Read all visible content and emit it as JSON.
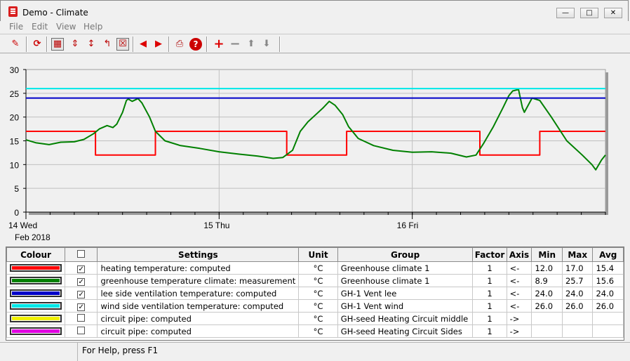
{
  "window": {
    "app": "Demo",
    "separator": " - ",
    "doc": "Climate"
  },
  "menu": [
    "File",
    "Edit",
    "View",
    "Help"
  ],
  "toolbar_icons": [
    "edit-icon",
    "refresh-icon",
    "grid-icon",
    "compress-vertical-icon",
    "expand-vertical-icon",
    "cursor-measure-icon",
    "clear-icon",
    "arrow-left-icon",
    "arrow-right-icon",
    "print-icon",
    "help-icon",
    "add-icon",
    "remove-icon",
    "move-up-icon",
    "move-down-icon"
  ],
  "chart_data": {
    "type": "line",
    "ylim": [
      0,
      30
    ],
    "yticks": [
      0,
      5,
      10,
      15,
      20,
      25,
      30
    ],
    "xlim": [
      0,
      3
    ],
    "x_unit": "days from 14 Feb 2018 00:00",
    "xticks": [
      {
        "x": 0,
        "label": "14 Wed",
        "sub": "Feb 2018"
      },
      {
        "x": 1,
        "label": "15 Thu",
        "sub": ""
      },
      {
        "x": 2,
        "label": "16 Fri",
        "sub": ""
      }
    ],
    "grid": true,
    "series": [
      {
        "name": "heating temperature: computed",
        "color": "#ff0000",
        "step": true,
        "x": [
          0,
          0.36,
          0.36,
          0.67,
          0.67,
          1.35,
          1.35,
          1.66,
          1.66,
          2.35,
          2.35,
          2.66,
          2.66,
          3.0
        ],
        "y": [
          17,
          17,
          12,
          12,
          17,
          17,
          12,
          12,
          17,
          17,
          12,
          12,
          17,
          17
        ]
      },
      {
        "name": "greenhouse temperature climate: measurement",
        "color": "#008000",
        "step": false,
        "x": [
          0,
          0.05,
          0.12,
          0.18,
          0.25,
          0.3,
          0.35,
          0.38,
          0.42,
          0.45,
          0.47,
          0.5,
          0.52,
          0.53,
          0.55,
          0.58,
          0.6,
          0.64,
          0.67,
          0.72,
          0.8,
          0.9,
          1.0,
          1.1,
          1.2,
          1.28,
          1.33,
          1.38,
          1.42,
          1.46,
          1.5,
          1.54,
          1.57,
          1.6,
          1.64,
          1.67,
          1.72,
          1.8,
          1.9,
          2.0,
          2.1,
          2.2,
          2.28,
          2.33,
          2.37,
          2.42,
          2.47,
          2.5,
          2.52,
          2.55,
          2.57,
          2.58,
          2.62,
          2.66,
          2.72,
          2.8,
          2.88,
          2.93,
          2.95,
          2.98,
          3.0
        ],
        "y": [
          15.2,
          14.6,
          14.2,
          14.7,
          14.8,
          15.3,
          16.5,
          17.5,
          18.2,
          17.8,
          18.5,
          21.0,
          23.5,
          23.8,
          23.3,
          23.9,
          23.0,
          20.0,
          17.0,
          15.0,
          14.0,
          13.4,
          12.7,
          12.2,
          11.8,
          11.3,
          11.5,
          13.0,
          17.0,
          19.0,
          20.5,
          22.0,
          23.3,
          22.5,
          20.5,
          18.0,
          15.5,
          14.0,
          13.0,
          12.6,
          12.7,
          12.4,
          11.6,
          12.0,
          14.5,
          18.0,
          22.0,
          24.5,
          25.5,
          25.8,
          22.0,
          21.0,
          24.0,
          23.5,
          20.0,
          15.0,
          12.0,
          10.0,
          8.9,
          11.0,
          12.0
        ]
      },
      {
        "name": "lee side ventilation temperature: computed",
        "color": "#0000c8",
        "step": false,
        "x": [
          0,
          3.0
        ],
        "y": [
          24,
          24
        ]
      },
      {
        "name": "wind side ventilation temperature: computed",
        "color": "#00e8e8",
        "step": false,
        "x": [
          0,
          3.0
        ],
        "y": [
          26,
          26
        ]
      }
    ]
  },
  "table": {
    "headers": [
      "Colour",
      "",
      "Settings",
      "Unit",
      "Group",
      "Factor",
      "Axis",
      "Min",
      "Max",
      "Avg"
    ],
    "rows": [
      {
        "color": "#ff0000",
        "checked": true,
        "setting": "heating temperature: computed",
        "unit": "°C",
        "group": "Greenhouse climate 1",
        "factor": "1",
        "axis": "<-",
        "min": "12.0",
        "max": "17.0",
        "avg": "15.4"
      },
      {
        "color": "#008000",
        "checked": true,
        "setting": "greenhouse temperature climate: measurement",
        "unit": "°C",
        "group": "Greenhouse climate 1",
        "factor": "1",
        "axis": "<-",
        "min": "8.9",
        "max": "25.7",
        "avg": "15.6"
      },
      {
        "color": "#0000c8",
        "checked": true,
        "setting": "lee side ventilation temperature: computed",
        "unit": "°C",
        "group": "GH-1 Vent lee",
        "factor": "1",
        "axis": "<-",
        "min": "24.0",
        "max": "24.0",
        "avg": "24.0"
      },
      {
        "color": "#00e8e8",
        "checked": true,
        "setting": "wind side ventilation temperature: computed",
        "unit": "°C",
        "group": "GH-1 Vent wind",
        "factor": "1",
        "axis": "<-",
        "min": "26.0",
        "max": "26.0",
        "avg": "26.0"
      },
      {
        "color": "#f0f000",
        "checked": false,
        "setting": "circuit pipe: computed",
        "unit": "°C",
        "group": "GH-seed Heating Circuit middle",
        "factor": "1",
        "axis": "->",
        "min": "",
        "max": "",
        "avg": ""
      },
      {
        "color": "#e000e0",
        "checked": false,
        "setting": "circuit pipe: computed",
        "unit": "°C",
        "group": "GH-seed Heating Circuit Sides",
        "factor": "1",
        "axis": "->",
        "min": "",
        "max": "",
        "avg": ""
      }
    ]
  },
  "status": {
    "help": "For Help, press F1"
  }
}
